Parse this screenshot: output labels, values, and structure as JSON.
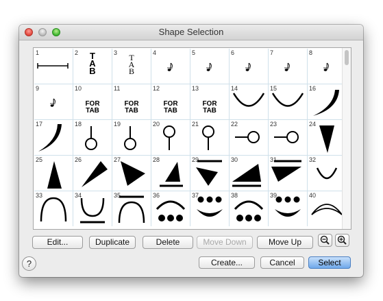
{
  "window": {
    "title": "Shape Selection"
  },
  "shapes": [
    {
      "num": "1",
      "icon": "horizontal-bracket-line-icon"
    },
    {
      "num": "2",
      "icon": "tab-clef-large-icon",
      "text": "TAB"
    },
    {
      "num": "3",
      "icon": "tab-clef-serif-icon",
      "text": "TAB"
    },
    {
      "num": "4",
      "icon": "small-note-icon"
    },
    {
      "num": "5",
      "icon": "small-note-icon"
    },
    {
      "num": "6",
      "icon": "small-note-icon"
    },
    {
      "num": "7",
      "icon": "small-note-icon"
    },
    {
      "num": "8",
      "icon": "small-note-icon"
    },
    {
      "num": "9",
      "icon": "small-note-icon"
    },
    {
      "num": "10",
      "icon": "for-tab-text-icon",
      "text": "FOR TAB"
    },
    {
      "num": "11",
      "icon": "for-tab-text-icon",
      "text": "FOR TAB"
    },
    {
      "num": "12",
      "icon": "for-tab-text-icon",
      "text": "FOR TAB"
    },
    {
      "num": "13",
      "icon": "for-tab-text-icon",
      "text": "FOR TAB"
    },
    {
      "num": "14",
      "icon": "down-arc-icon"
    },
    {
      "num": "15",
      "icon": "down-arc-icon"
    },
    {
      "num": "16",
      "icon": "thick-curve-right-icon"
    },
    {
      "num": "17",
      "icon": "thick-curve-left-icon"
    },
    {
      "num": "18",
      "icon": "circle-with-stem-up-icon"
    },
    {
      "num": "19",
      "icon": "circle-with-stem-up-icon"
    },
    {
      "num": "20",
      "icon": "circle-with-stem-down-icon"
    },
    {
      "num": "21",
      "icon": "circle-with-stem-down-icon"
    },
    {
      "num": "22",
      "icon": "circle-with-stem-left-icon"
    },
    {
      "num": "23",
      "icon": "circle-with-stem-left-icon"
    },
    {
      "num": "24",
      "icon": "down-triangle-icon"
    },
    {
      "num": "25",
      "icon": "up-triangle-icon"
    },
    {
      "num": "26",
      "icon": "right-triangle-icon"
    },
    {
      "num": "27",
      "icon": "right-triangle-tilted-icon"
    },
    {
      "num": "28",
      "icon": "triangle-over-line-icon"
    },
    {
      "num": "29",
      "icon": "line-over-triangle-icon"
    },
    {
      "num": "30",
      "icon": "wedge-over-line-icon"
    },
    {
      "num": "31",
      "icon": "line-over-wedge-icon"
    },
    {
      "num": "32",
      "icon": "up-arc-icon"
    },
    {
      "num": "33",
      "icon": "arch-icon"
    },
    {
      "num": "34",
      "icon": "arc-over-line-icon"
    },
    {
      "num": "35",
      "icon": "line-over-arch-icon"
    },
    {
      "num": "36",
      "icon": "arch-over-dots-icon"
    },
    {
      "num": "37",
      "icon": "dots-over-smile-icon"
    },
    {
      "num": "38",
      "icon": "arch-over-dots-icon"
    },
    {
      "num": "39",
      "icon": "dots-over-smile-icon"
    },
    {
      "num": "40",
      "icon": "crescent-arch-icon"
    }
  ],
  "buttons": {
    "edit": "Edit...",
    "duplicate": "Duplicate",
    "delete": "Delete",
    "move_down": "Move Down",
    "move_up": "Move Up",
    "create": "Create...",
    "cancel": "Cancel",
    "select": "Select",
    "help": "?"
  },
  "icons": {
    "zoom_out": "zoom-out-icon",
    "zoom_in": "zoom-in-icon"
  },
  "colors": {
    "default_button": "#6fa8ea",
    "grid_lines": "#cfe0ea"
  }
}
